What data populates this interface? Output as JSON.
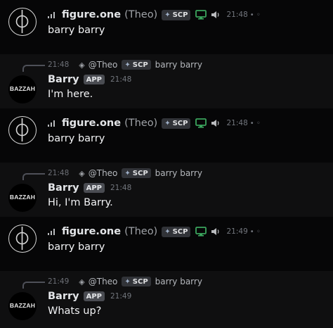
{
  "messages": [
    {
      "kind": "user",
      "username": "figure.one",
      "nickname": "(Theo)",
      "tag": "SCP",
      "time": "21:48",
      "content": "barry barry"
    },
    {
      "kind": "bot",
      "reply": {
        "time": "21:48",
        "mention": "@Theo",
        "tag": "SCP",
        "text": "barry barry"
      },
      "avatar_text": "BAZZAH",
      "username": "Barry",
      "badge": "APP",
      "time": "21:48",
      "content": "I'm here."
    },
    {
      "kind": "user",
      "username": "figure.one",
      "nickname": "(Theo)",
      "tag": "SCP",
      "time": "21:48",
      "content": "barry barry"
    },
    {
      "kind": "bot",
      "reply": {
        "time": "21:48",
        "mention": "@Theo",
        "tag": "SCP",
        "text": "barry barry"
      },
      "avatar_text": "BAZZAH",
      "username": "Barry",
      "badge": "APP",
      "time": "21:48",
      "content": "Hi, I'm Barry."
    },
    {
      "kind": "user",
      "username": "figure.one",
      "nickname": "(Theo)",
      "tag": "SCP",
      "time": "21:49",
      "content": "barry barry"
    },
    {
      "kind": "bot",
      "reply": {
        "time": "21:49",
        "mention": "@Theo",
        "tag": "SCP",
        "text": "barry barry"
      },
      "avatar_text": "BAZZAH",
      "username": "Barry",
      "badge": "APP",
      "time": "21:49",
      "content": "Whats up?"
    }
  ],
  "icons": {
    "signal": "signal-bars-icon",
    "tag": "diamond-gem-icon",
    "monitor": "monitor-icon",
    "speaker": "speaker-icon",
    "reply": "reply-diamond-icon"
  },
  "colors": {
    "monitor": "#3ba55d",
    "user_bg": "#060607",
    "bot_bg": "#0f0f10"
  }
}
